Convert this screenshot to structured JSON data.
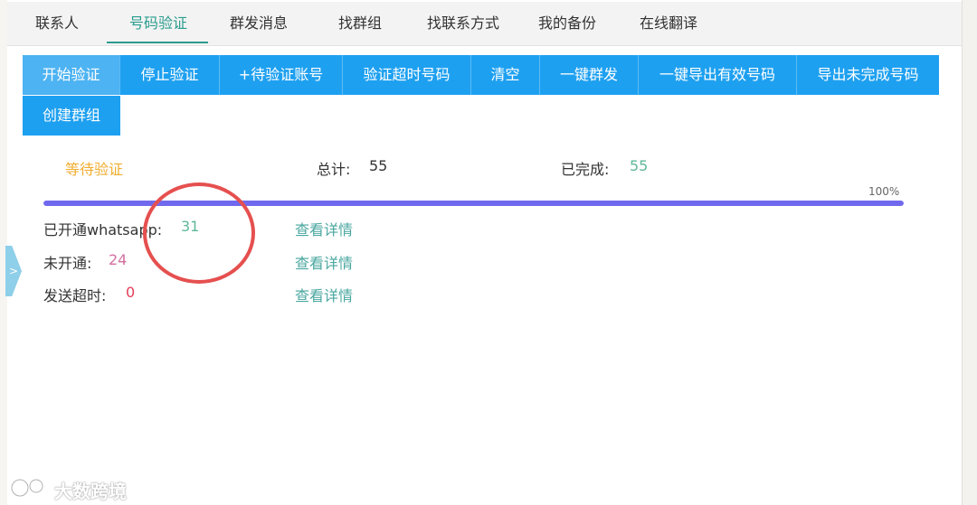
{
  "tabs": [
    "联系人",
    "号码验证",
    "群发消息",
    "找群组",
    "找联系方式",
    "我的备份",
    "在线翻译"
  ],
  "active_tab": "号码验证",
  "buttons": [
    "开始验证",
    "停止验证",
    "+待验证账号",
    "验证超时号码",
    "清空",
    "一键群发",
    "一键导出有效号码",
    "导出未完成号码",
    "创建群组"
  ],
  "status": {
    "state": "等待验证",
    "total_label": "总计:",
    "total": "55",
    "done_label": "已完成:",
    "done": "55"
  },
  "progress": {
    "percent": 100,
    "percent_label": "100%"
  },
  "stats": [
    {
      "label": "已开通whatsapp:",
      "value": "31",
      "link": "查看详情"
    },
    {
      "label": "未开通:",
      "value": "24",
      "link": "查看详情"
    },
    {
      "label": "发送超时:",
      "value": "0",
      "link": "查看详情"
    }
  ],
  "side_handle": ">",
  "watermark": "大数跨境",
  "colors": {
    "accent_tab": "#2b9c8e",
    "button": "#1ea0f0",
    "progress": "#7069ee",
    "highlight_circle": "#e5504f"
  }
}
